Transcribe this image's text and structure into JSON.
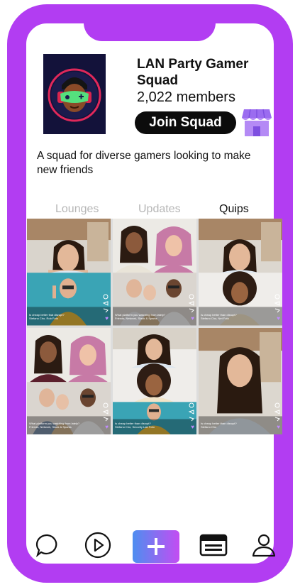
{
  "squad": {
    "name": "LAN Party Gamer Squad",
    "members": "2,022 members",
    "join_label": "Join Squad",
    "description": "A squad for diverse gamers looking to make new friends"
  },
  "tabs": [
    {
      "label": "Lounges",
      "active": false
    },
    {
      "label": "Updates",
      "active": false
    },
    {
      "label": "Quips",
      "active": true
    }
  ],
  "quips": [
    {
      "caption": "Is cheap better that disrupt?",
      "byline": "Stefano Cho, Rob Foto"
    },
    {
      "caption": "What platform you watching from lately?",
      "byline": "Friends, Network, Stack & Sparks"
    },
    {
      "caption": "Is cheap better than disrupt?",
      "byline": "Stefano Cho, Net Foto"
    },
    {
      "caption": "What platform you watching from lately?",
      "byline": "Friends, Network, Stack & Sparks"
    },
    {
      "caption": "Is cheap better than disrupt?",
      "byline": "Stefano Cho, Security Lab Foto"
    },
    {
      "caption": "Is cheap better than disrupt?",
      "byline": "Stefano Cho"
    }
  ],
  "colors": {
    "frame": "#b23df2",
    "accent_gradient": [
      "#4e8ef0",
      "#c34df2"
    ],
    "heart": "#c08cff"
  },
  "icons": {
    "nav": [
      "chat-bubble-icon",
      "play-circle-icon",
      "plus-icon",
      "browser-window-icon",
      "profile-icon"
    ],
    "store": "storefront-icon"
  }
}
